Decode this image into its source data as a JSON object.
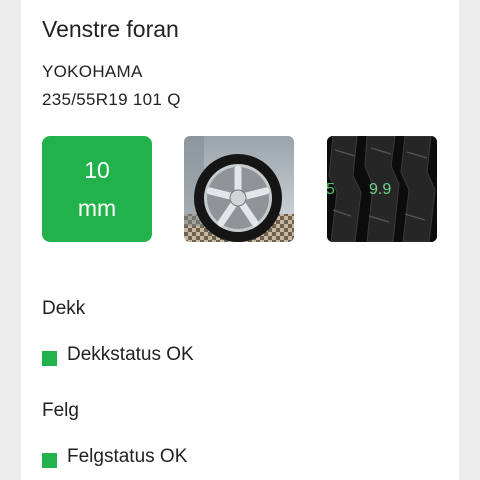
{
  "position_title": "Venstre foran",
  "tire": {
    "brand": "YOKOHAMA",
    "size": "235/55R19 101 Q"
  },
  "tread": {
    "value": "10",
    "unit": "mm",
    "color": "#22b24c"
  },
  "photos": [
    {
      "name": "wheel-photo"
    },
    {
      "name": "tread-photo",
      "overlay_left": "5",
      "overlay_value": "9.9"
    }
  ],
  "sections": {
    "tire": {
      "label": "Dekk",
      "status": "Dekkstatus OK",
      "status_color": "#22b24c"
    },
    "rim": {
      "label": "Felg",
      "status": "Felgstatus OK",
      "status_color": "#22b24c"
    }
  }
}
